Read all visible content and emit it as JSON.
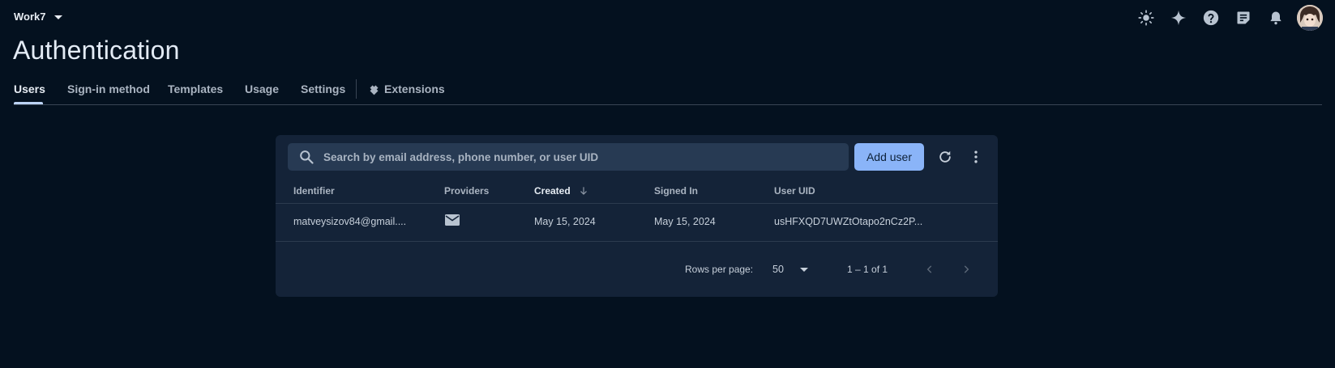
{
  "header": {
    "project_name": "Work7",
    "icons": [
      "theme-brightness-icon",
      "gemini-sparkle-icon",
      "help-icon",
      "release-notes-icon",
      "notifications-bell-icon"
    ]
  },
  "page": {
    "title": "Authentication"
  },
  "tabs": [
    {
      "label": "Users",
      "active": true
    },
    {
      "label": "Sign-in method"
    },
    {
      "label": "Templates"
    },
    {
      "label": "Usage"
    },
    {
      "label": "Settings"
    },
    {
      "label": "Extensions",
      "icon": "extensions-icon"
    }
  ],
  "toolbar": {
    "search_placeholder": "Search by email address, phone number, or user UID",
    "add_user_label": "Add user"
  },
  "table": {
    "columns": [
      "Identifier",
      "Providers",
      "Created",
      "Signed In",
      "User UID"
    ],
    "sorted_column": "Created",
    "rows": [
      {
        "identifier": "matveysizov84@gmail....",
        "provider_icon": "email-icon",
        "created": "May 15, 2024",
        "signed_in": "May 15, 2024",
        "uid": "usHFXQD7UWZtOtapo2nCz2P..."
      }
    ]
  },
  "pagination": {
    "rows_per_page_label": "Rows per page:",
    "rows_per_page": "50",
    "range": "1 – 1 of 1"
  },
  "colors": {
    "background": "#04111f",
    "card": "#142338",
    "accent": "#8ab4f8"
  }
}
